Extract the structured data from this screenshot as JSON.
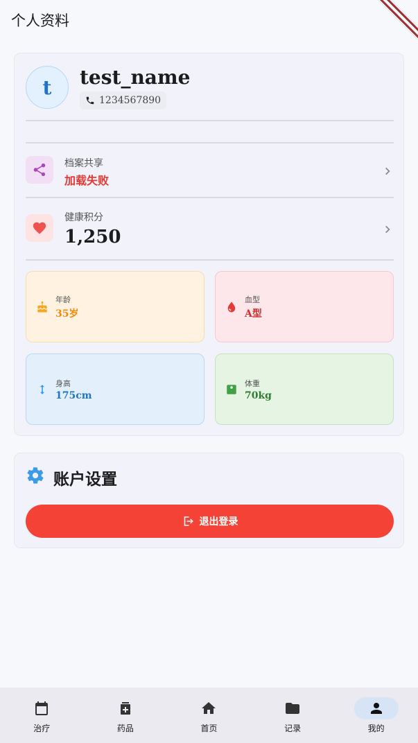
{
  "appbar": {
    "title": "个人资料"
  },
  "profile": {
    "avatar_letter": "t",
    "name": "test_name",
    "phone": "1234567890"
  },
  "rows": {
    "share": {
      "label": "档案共享",
      "value": "加载失败"
    },
    "points": {
      "label": "健康积分",
      "value": "1,250"
    }
  },
  "stats": {
    "age": {
      "label": "年龄",
      "value": "35岁"
    },
    "blood": {
      "label": "血型",
      "value": "A型"
    },
    "height": {
      "label": "身高",
      "value": "175cm"
    },
    "weight": {
      "label": "体重",
      "value": "70kg"
    }
  },
  "settings": {
    "title": "账户设置",
    "logout_label": "退出登录"
  },
  "nav": {
    "items": [
      {
        "label": "治疗",
        "icon": "calendar-icon",
        "active": false
      },
      {
        "label": "药品",
        "icon": "medicine-icon",
        "active": false
      },
      {
        "label": "首页",
        "icon": "home-icon",
        "active": false
      },
      {
        "label": "记录",
        "icon": "folder-icon",
        "active": false
      },
      {
        "label": "我的",
        "icon": "person-icon",
        "active": true
      }
    ]
  },
  "colors": {
    "accent": "#1e74c9",
    "error": "#e53935",
    "logout": "#f44336"
  }
}
